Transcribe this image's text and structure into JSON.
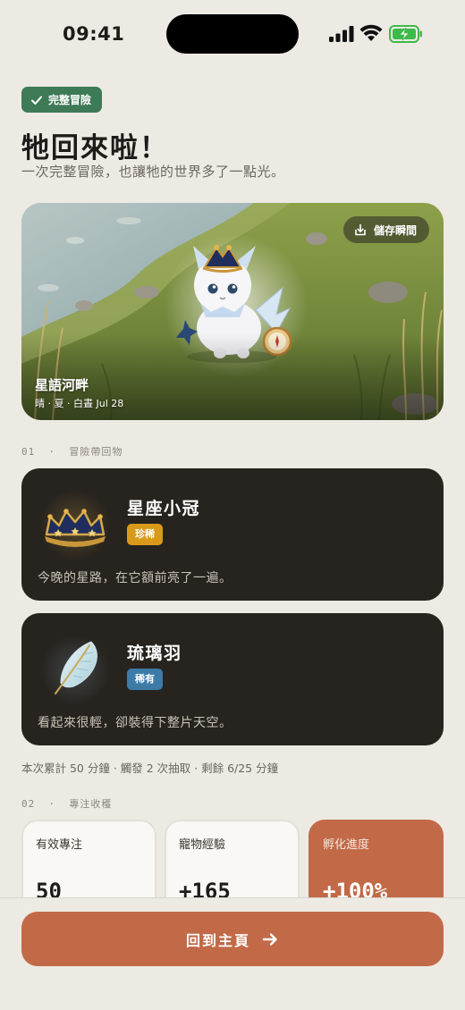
{
  "status_bar": {
    "time": "09:41"
  },
  "badge": {
    "label": "完整冒險"
  },
  "header": {
    "title": "牠回來啦！",
    "subtitle": "一次完整冒險，也讓牠的世界多了一點光。"
  },
  "hero": {
    "save_label": "儲存瞬間",
    "place": "星語河畔",
    "meta": "晴 · 夏 · 白晝  Jul 28"
  },
  "sections": {
    "loot": {
      "number": "01",
      "sep": "·",
      "name": "冒險帶回物"
    },
    "focus": {
      "number": "02",
      "sep": "·",
      "name": "專注收穫"
    }
  },
  "items": [
    {
      "name": "星座小冠",
      "rarity": "珍稀",
      "rarity_color": "#D99A1A",
      "description": "今晚的星路，在它額前亮了一遍。",
      "icon": "star-crown-icon"
    },
    {
      "name": "琉璃羽",
      "rarity": "稀有",
      "rarity_color": "#3C7BA8",
      "description": "看起來很輕，卻裝得下整片天空。",
      "icon": "glass-feather-icon"
    }
  ],
  "summary": "本次累計 50 分鐘 · 觸發 2 次抽取 · 剩餘 6/25 分鐘",
  "stats": [
    {
      "label": "有效專注",
      "value": "50"
    },
    {
      "label": "寵物經驗",
      "value": "+165"
    },
    {
      "label": "孵化進度",
      "value": "+100%"
    }
  ],
  "cta": {
    "label": "回到主頁"
  },
  "colors": {
    "accent": "#C26A48",
    "success": "#3E7A56",
    "card_dark": "#27231E"
  }
}
